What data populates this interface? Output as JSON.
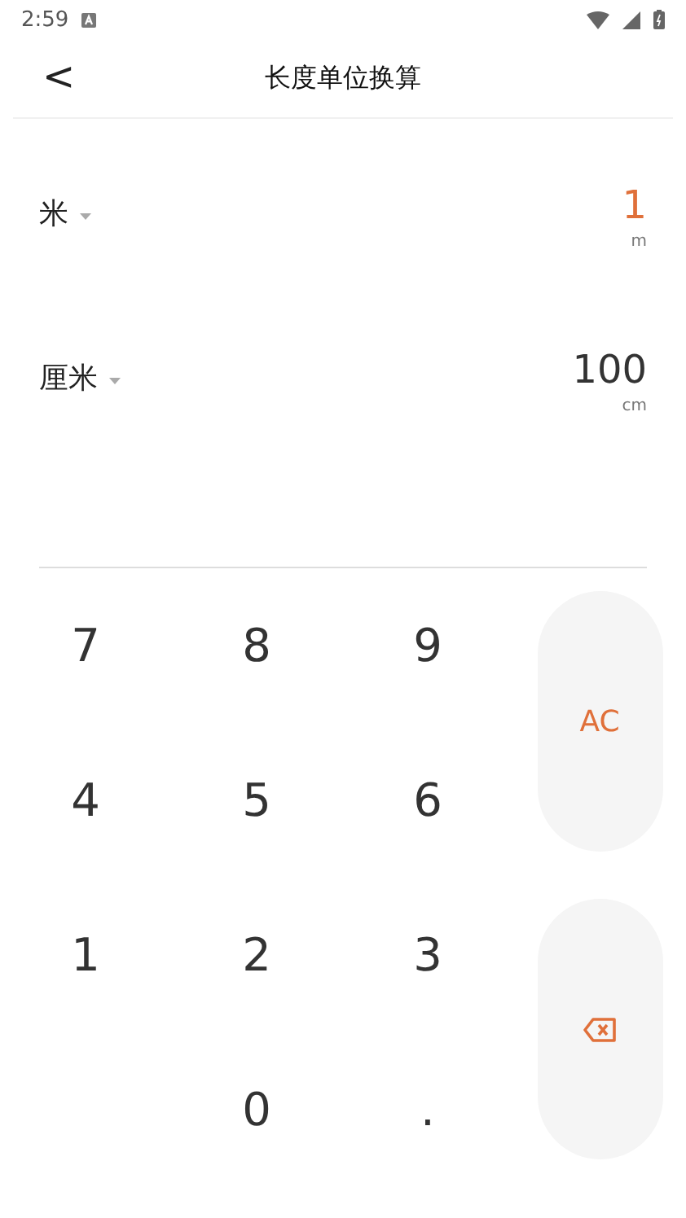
{
  "status_bar": {
    "time": "2:59"
  },
  "header": {
    "back": "<",
    "title": "长度单位换算"
  },
  "units": [
    {
      "name": "米",
      "value": "1",
      "symbol": "m",
      "active": true
    },
    {
      "name": "厘米",
      "value": "100",
      "symbol": "cm",
      "active": false
    }
  ],
  "keypad": {
    "keys": [
      "7",
      "8",
      "9",
      "4",
      "5",
      "6",
      "1",
      "2",
      "3",
      "0",
      "."
    ],
    "clear": "AC"
  }
}
